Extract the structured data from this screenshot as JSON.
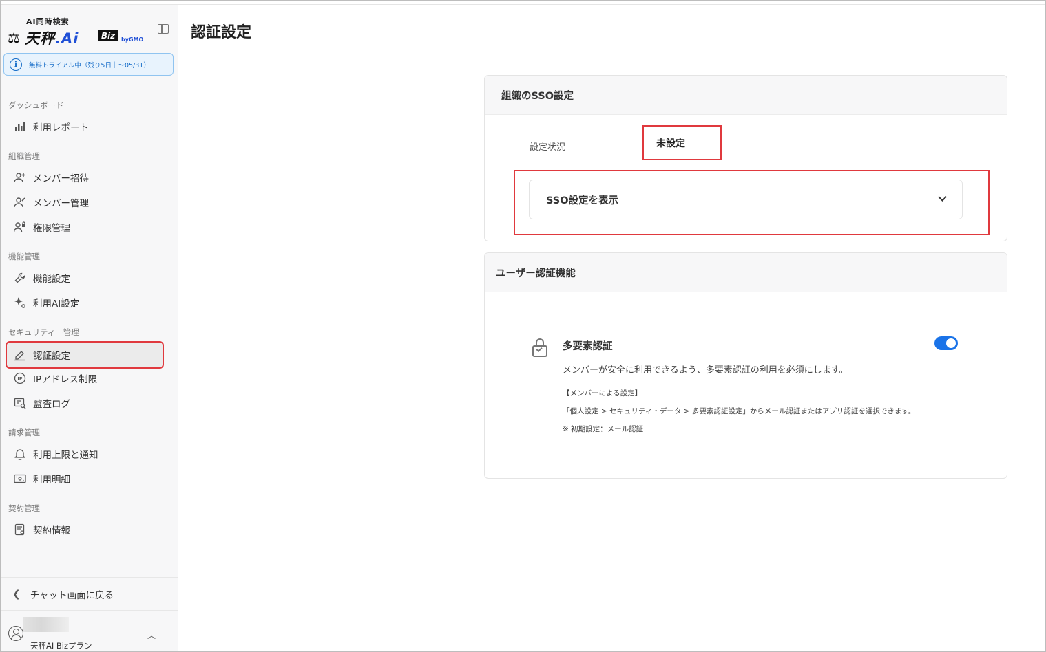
{
  "logo": {
    "sub": "AI同時検索",
    "main_prefix": "天秤",
    "main_ai": ".Ai",
    "biz": "Biz",
    "gmo": "byGMO"
  },
  "trial": {
    "text": "無料トライアル中（残り5日｜〜05/31）"
  },
  "sidebar": {
    "sections": [
      {
        "label": "ダッシュボード"
      },
      {
        "label": "組織管理"
      },
      {
        "label": "機能管理"
      },
      {
        "label": "セキュリティー管理"
      },
      {
        "label": "請求管理"
      },
      {
        "label": "契約管理"
      }
    ],
    "items": [
      {
        "label": "利用レポート",
        "icon": "bar-chart-icon"
      },
      {
        "label": "メンバー招待",
        "icon": "user-plus-icon"
      },
      {
        "label": "メンバー管理",
        "icon": "user-edit-icon"
      },
      {
        "label": "権限管理",
        "icon": "user-lock-icon"
      },
      {
        "label": "機能設定",
        "icon": "wrench-icon"
      },
      {
        "label": "利用AI設定",
        "icon": "sparkle-icon"
      },
      {
        "label": "認証設定",
        "icon": "signature-icon"
      },
      {
        "label": "IPアドレス制限",
        "icon": "ip-icon"
      },
      {
        "label": "監査ログ",
        "icon": "audit-log-icon"
      },
      {
        "label": "利用上限と通知",
        "icon": "bell-icon"
      },
      {
        "label": "利用明細",
        "icon": "receipt-icon"
      },
      {
        "label": "契約情報",
        "icon": "contract-icon"
      }
    ],
    "back_label": "チャット画面に戻る",
    "user_plan": "天秤AI Bizプラン"
  },
  "page": {
    "title": "認証設定"
  },
  "sso": {
    "header": "組織のSSO設定",
    "status_label": "設定状況",
    "status_value": "未設定",
    "accordion_label": "SSO設定を表示"
  },
  "auth": {
    "header": "ユーザー認証機能",
    "mfa_title": "多要素認証",
    "mfa_enabled": true,
    "mfa_desc": "メンバーが安全に利用できるよう、多要素認証の利用を必須にします。",
    "note_title": "【メンバーによる設定】",
    "note_path": "「個人設定 > セキュリティ・データ > 多要素認証設定」からメール認証またはアプリ認証を選択できます。",
    "note_default": "※ 初期設定：メール認証"
  },
  "colors": {
    "accent": "#1a73e8",
    "highlight": "#e0393e",
    "trial_text": "#1a6fc9"
  }
}
